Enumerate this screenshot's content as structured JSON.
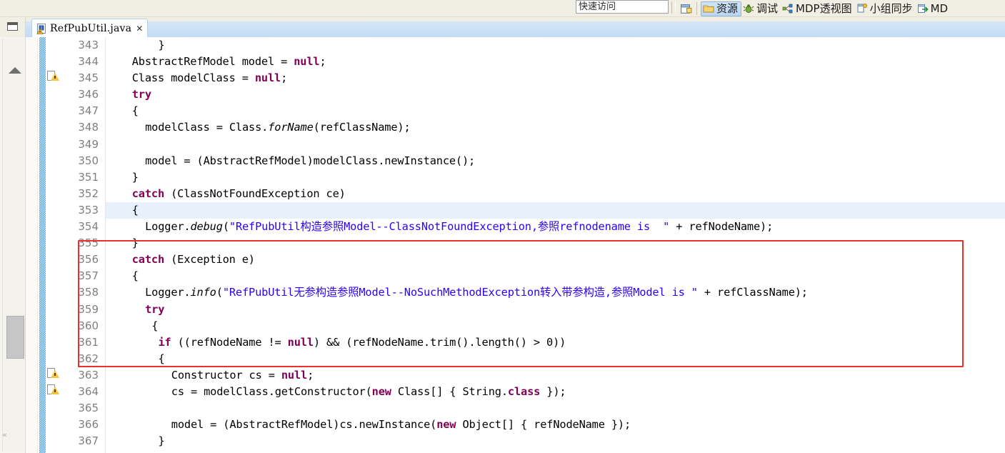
{
  "toolbar": {
    "quick_access_placeholder": "快速访问",
    "open_perspective_icon": "open-perspective-icon",
    "perspectives": [
      {
        "label": "资源",
        "icon": "resource-perspective-icon",
        "active": true
      },
      {
        "label": "调试",
        "icon": "debug-perspective-icon",
        "active": false
      },
      {
        "label": "MDP透视图",
        "icon": "mdp-perspective-icon",
        "active": false
      },
      {
        "label": "小组同步",
        "icon": "team-sync-perspective-icon",
        "active": false
      },
      {
        "label": "MD",
        "icon": "md-perspective-icon",
        "active": false
      }
    ]
  },
  "left_strip": {
    "restore_label": "restore-icon",
    "scroll_up_label": "scroll-up-arrow",
    "bottom_mark": "«"
  },
  "editor": {
    "tab": {
      "title": "RefPubUtil.java",
      "close_glyph": "✕",
      "icon": "java-file-warning-icon"
    },
    "first_line_number": 343,
    "current_line": 353,
    "lines": [
      {
        "n": 343,
        "indent": 8,
        "marker": "",
        "text": "}"
      },
      {
        "n": 344,
        "indent": 4,
        "marker": "",
        "text": "AbstractRefModel model = null;"
      },
      {
        "n": 345,
        "indent": 4,
        "marker": "warn",
        "text": "Class modelClass = null;"
      },
      {
        "n": 346,
        "indent": 4,
        "marker": "",
        "text": "try"
      },
      {
        "n": 347,
        "indent": 4,
        "marker": "",
        "text": "{"
      },
      {
        "n": 348,
        "indent": 6,
        "marker": "",
        "text": "modelClass = Class.forName(refClassName);"
      },
      {
        "n": 349,
        "indent": 0,
        "marker": "",
        "text": ""
      },
      {
        "n": 350,
        "indent": 6,
        "marker": "",
        "text": "model = (AbstractRefModel)modelClass.newInstance();"
      },
      {
        "n": 351,
        "indent": 4,
        "marker": "",
        "text": "}"
      },
      {
        "n": 352,
        "indent": 4,
        "marker": "",
        "text": "catch (ClassNotFoundException ce)"
      },
      {
        "n": 353,
        "indent": 4,
        "marker": "",
        "text": "{"
      },
      {
        "n": 354,
        "indent": 6,
        "marker": "",
        "text": "Logger.debug(\"RefPubUtil构造参照Model--ClassNotFoundException,参照refnodename is  \" + refNodeName);"
      },
      {
        "n": 355,
        "indent": 4,
        "marker": "",
        "text": "}"
      },
      {
        "n": 356,
        "indent": 4,
        "marker": "",
        "text": "catch (Exception e)"
      },
      {
        "n": 357,
        "indent": 4,
        "marker": "",
        "text": "{"
      },
      {
        "n": 358,
        "indent": 6,
        "marker": "",
        "text": "Logger.info(\"RefPubUtil无参构造参照Model--NoSuchMethodException转入带参构造,参照Model is \" + refClassName);"
      },
      {
        "n": 359,
        "indent": 6,
        "marker": "",
        "text": "try"
      },
      {
        "n": 360,
        "indent": 7,
        "marker": "",
        "text": "{"
      },
      {
        "n": 361,
        "indent": 8,
        "marker": "",
        "text": "if ((refNodeName != null) && (refNodeName.trim().length() > 0))"
      },
      {
        "n": 362,
        "indent": 8,
        "marker": "",
        "text": "{"
      },
      {
        "n": 363,
        "indent": 10,
        "marker": "warn",
        "text": "Constructor cs = null;"
      },
      {
        "n": 364,
        "indent": 10,
        "marker": "warn",
        "text": "cs = modelClass.getConstructor(new Class[] { String.class });"
      },
      {
        "n": 365,
        "indent": 0,
        "marker": "",
        "text": ""
      },
      {
        "n": 366,
        "indent": 10,
        "marker": "",
        "text": "model = (AbstractRefModel)cs.newInstance(new Object[] { refNodeName });"
      },
      {
        "n": 367,
        "indent": 8,
        "marker": "",
        "text": "}"
      }
    ]
  },
  "annotation": {
    "shape": "rectangle",
    "color": "#e8312a",
    "covers_lines": "352-360"
  },
  "colors": {
    "keyword": "#7f0055",
    "string": "#2a00ff",
    "line_number": "#808080",
    "current_line_bg": "#e8f0fc",
    "change_bar": "#5aa8e0",
    "annotation_red": "#e8312a",
    "toolbar_bg": "#f1eee3",
    "tab_active_bg": "#ffffff"
  }
}
